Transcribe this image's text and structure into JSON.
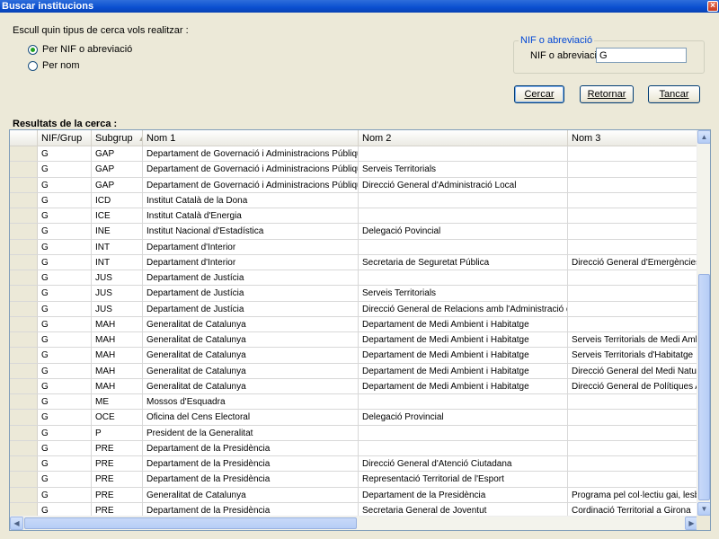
{
  "window": {
    "title": "Buscar institucions",
    "close_label": "×"
  },
  "search": {
    "prompt": "Escull quin tipus de cerca vols realitzar :",
    "options": [
      {
        "label": "Per NIF o abreviació",
        "selected": true
      },
      {
        "label": "Per nom",
        "selected": false
      }
    ],
    "group_title": "NIF o abreviació",
    "field_label": "NIF o abreviació :",
    "field_value": "G"
  },
  "buttons": {
    "search": "Cercar",
    "back": "Retornar",
    "close": "Tancar"
  },
  "results": {
    "title": "Resultats de la cerca :",
    "columns": [
      "",
      "NIF/Grup",
      "Subgrup",
      "Nom 1",
      "Nom 2",
      "Nom 3"
    ],
    "rows": [
      [
        "G",
        "GAP",
        "Departament de Governació i Administracions Públiques",
        "",
        ""
      ],
      [
        "G",
        "GAP",
        "Departament de Governació i Administracions Públiques",
        "Serveis Territorials",
        ""
      ],
      [
        "G",
        "GAP",
        "Departament de Governació i Administracions Públiques",
        "Direcció General d'Administració Local",
        ""
      ],
      [
        "G",
        "ICD",
        "Institut Català de la Dona",
        "",
        ""
      ],
      [
        "G",
        "ICE",
        "Institut Català d'Energia",
        "",
        ""
      ],
      [
        "G",
        "INE",
        "Institut Nacional d'Estadística",
        "Delegació Povincial",
        ""
      ],
      [
        "G",
        "INT",
        "Departament d'Interior",
        "",
        ""
      ],
      [
        "G",
        "INT",
        "Departament d'Interior",
        "Secretaria de Seguretat Pública",
        "Direcció General d'Emergències i Segu"
      ],
      [
        "G",
        "JUS",
        "Departament de Justícia",
        "",
        ""
      ],
      [
        "G",
        "JUS",
        "Departament de Justícia",
        "Serveis Territorials",
        ""
      ],
      [
        "G",
        "JUS",
        "Departament de Justícia",
        "Direcció General de Relacions amb l'Administració de Justícia",
        ""
      ],
      [
        "G",
        "MAH",
        "Generalitat de Catalunya",
        "Departament de Medi Ambient i Habitatge",
        ""
      ],
      [
        "G",
        "MAH",
        "Generalitat de Catalunya",
        "Departament de Medi Ambient i Habitatge",
        "Serveis Territorials de Medi Ambient"
      ],
      [
        "G",
        "MAH",
        "Generalitat de Catalunya",
        "Departament de Medi Ambient i Habitatge",
        "Serveis Territorials d'Habitatge"
      ],
      [
        "G",
        "MAH",
        "Generalitat de Catalunya",
        "Departament de Medi Ambient i Habitatge",
        "Direcció General del Medi Natural"
      ],
      [
        "G",
        "MAH",
        "Generalitat de Catalunya",
        "Departament de Medi Ambient i Habitatge",
        "Direcció General de Polítiques Ambien"
      ],
      [
        "G",
        "ME",
        "Mossos d'Esquadra",
        "",
        ""
      ],
      [
        "G",
        "OCE",
        "Oficina del Cens Electoral",
        "Delegació Provincial",
        ""
      ],
      [
        "G",
        "P",
        "President de la Generalitat",
        "",
        ""
      ],
      [
        "G",
        "PRE",
        "Departament de la Presidència",
        "",
        ""
      ],
      [
        "G",
        "PRE",
        "Departament de la Presidència",
        "Direcció General d'Atenció Ciutadana",
        ""
      ],
      [
        "G",
        "PRE",
        "Departament de la Presidència",
        "Representació Territorial de l'Esport",
        ""
      ],
      [
        "G",
        "PRE",
        "Generalitat de Catalunya",
        "Departament de la Presidència",
        "Programa pel col·lectiu gai, lesbianes i"
      ],
      [
        "G",
        "PRE",
        "Departament de la Presidència",
        "Secretaria General de Joventut",
        "Cordinació Territorial a Girona"
      ]
    ]
  }
}
